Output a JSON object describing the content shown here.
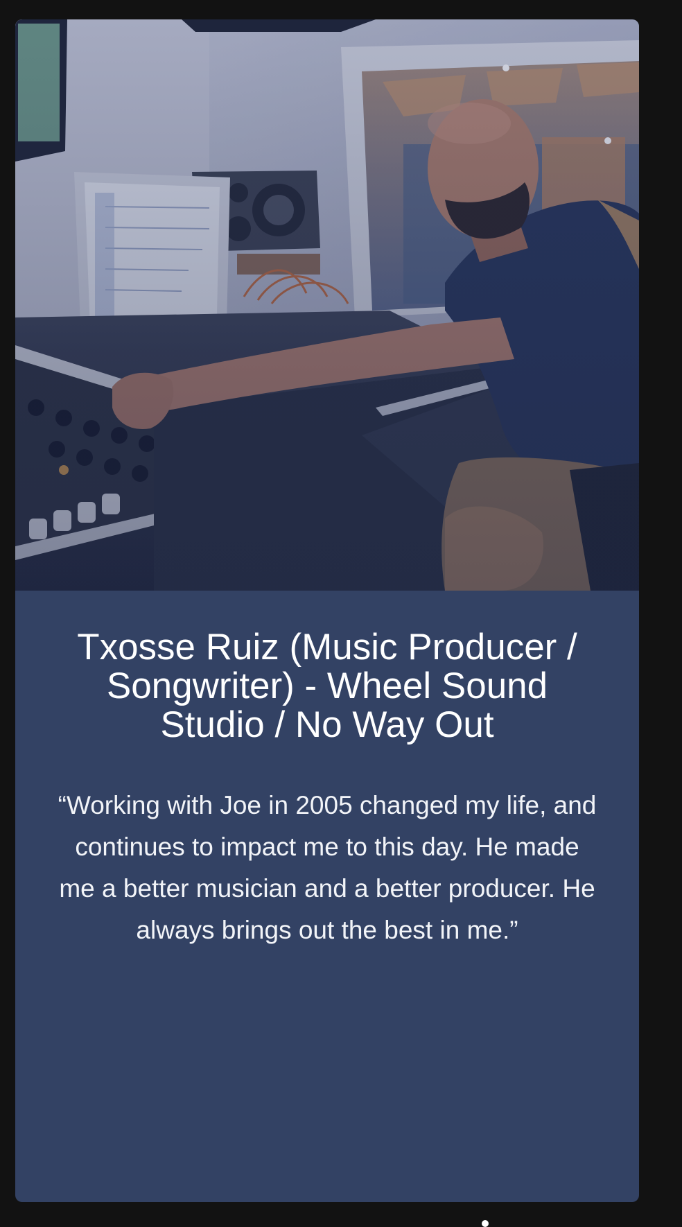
{
  "testimonial": {
    "image_alt": "Music producer at a studio mixing console",
    "title": "Txosse Ruiz (Music Producer / Songwriter) - Wheel Sound Studio / No Way Out",
    "quote": "“Working with Joe in 2005 changed my life, and continues to impact me to this day. He made me a better musician and a better producer. He always brings out the best in me.”"
  },
  "colors": {
    "page_background": "#121212",
    "card_background": "#334264",
    "text": "#ffffff"
  }
}
